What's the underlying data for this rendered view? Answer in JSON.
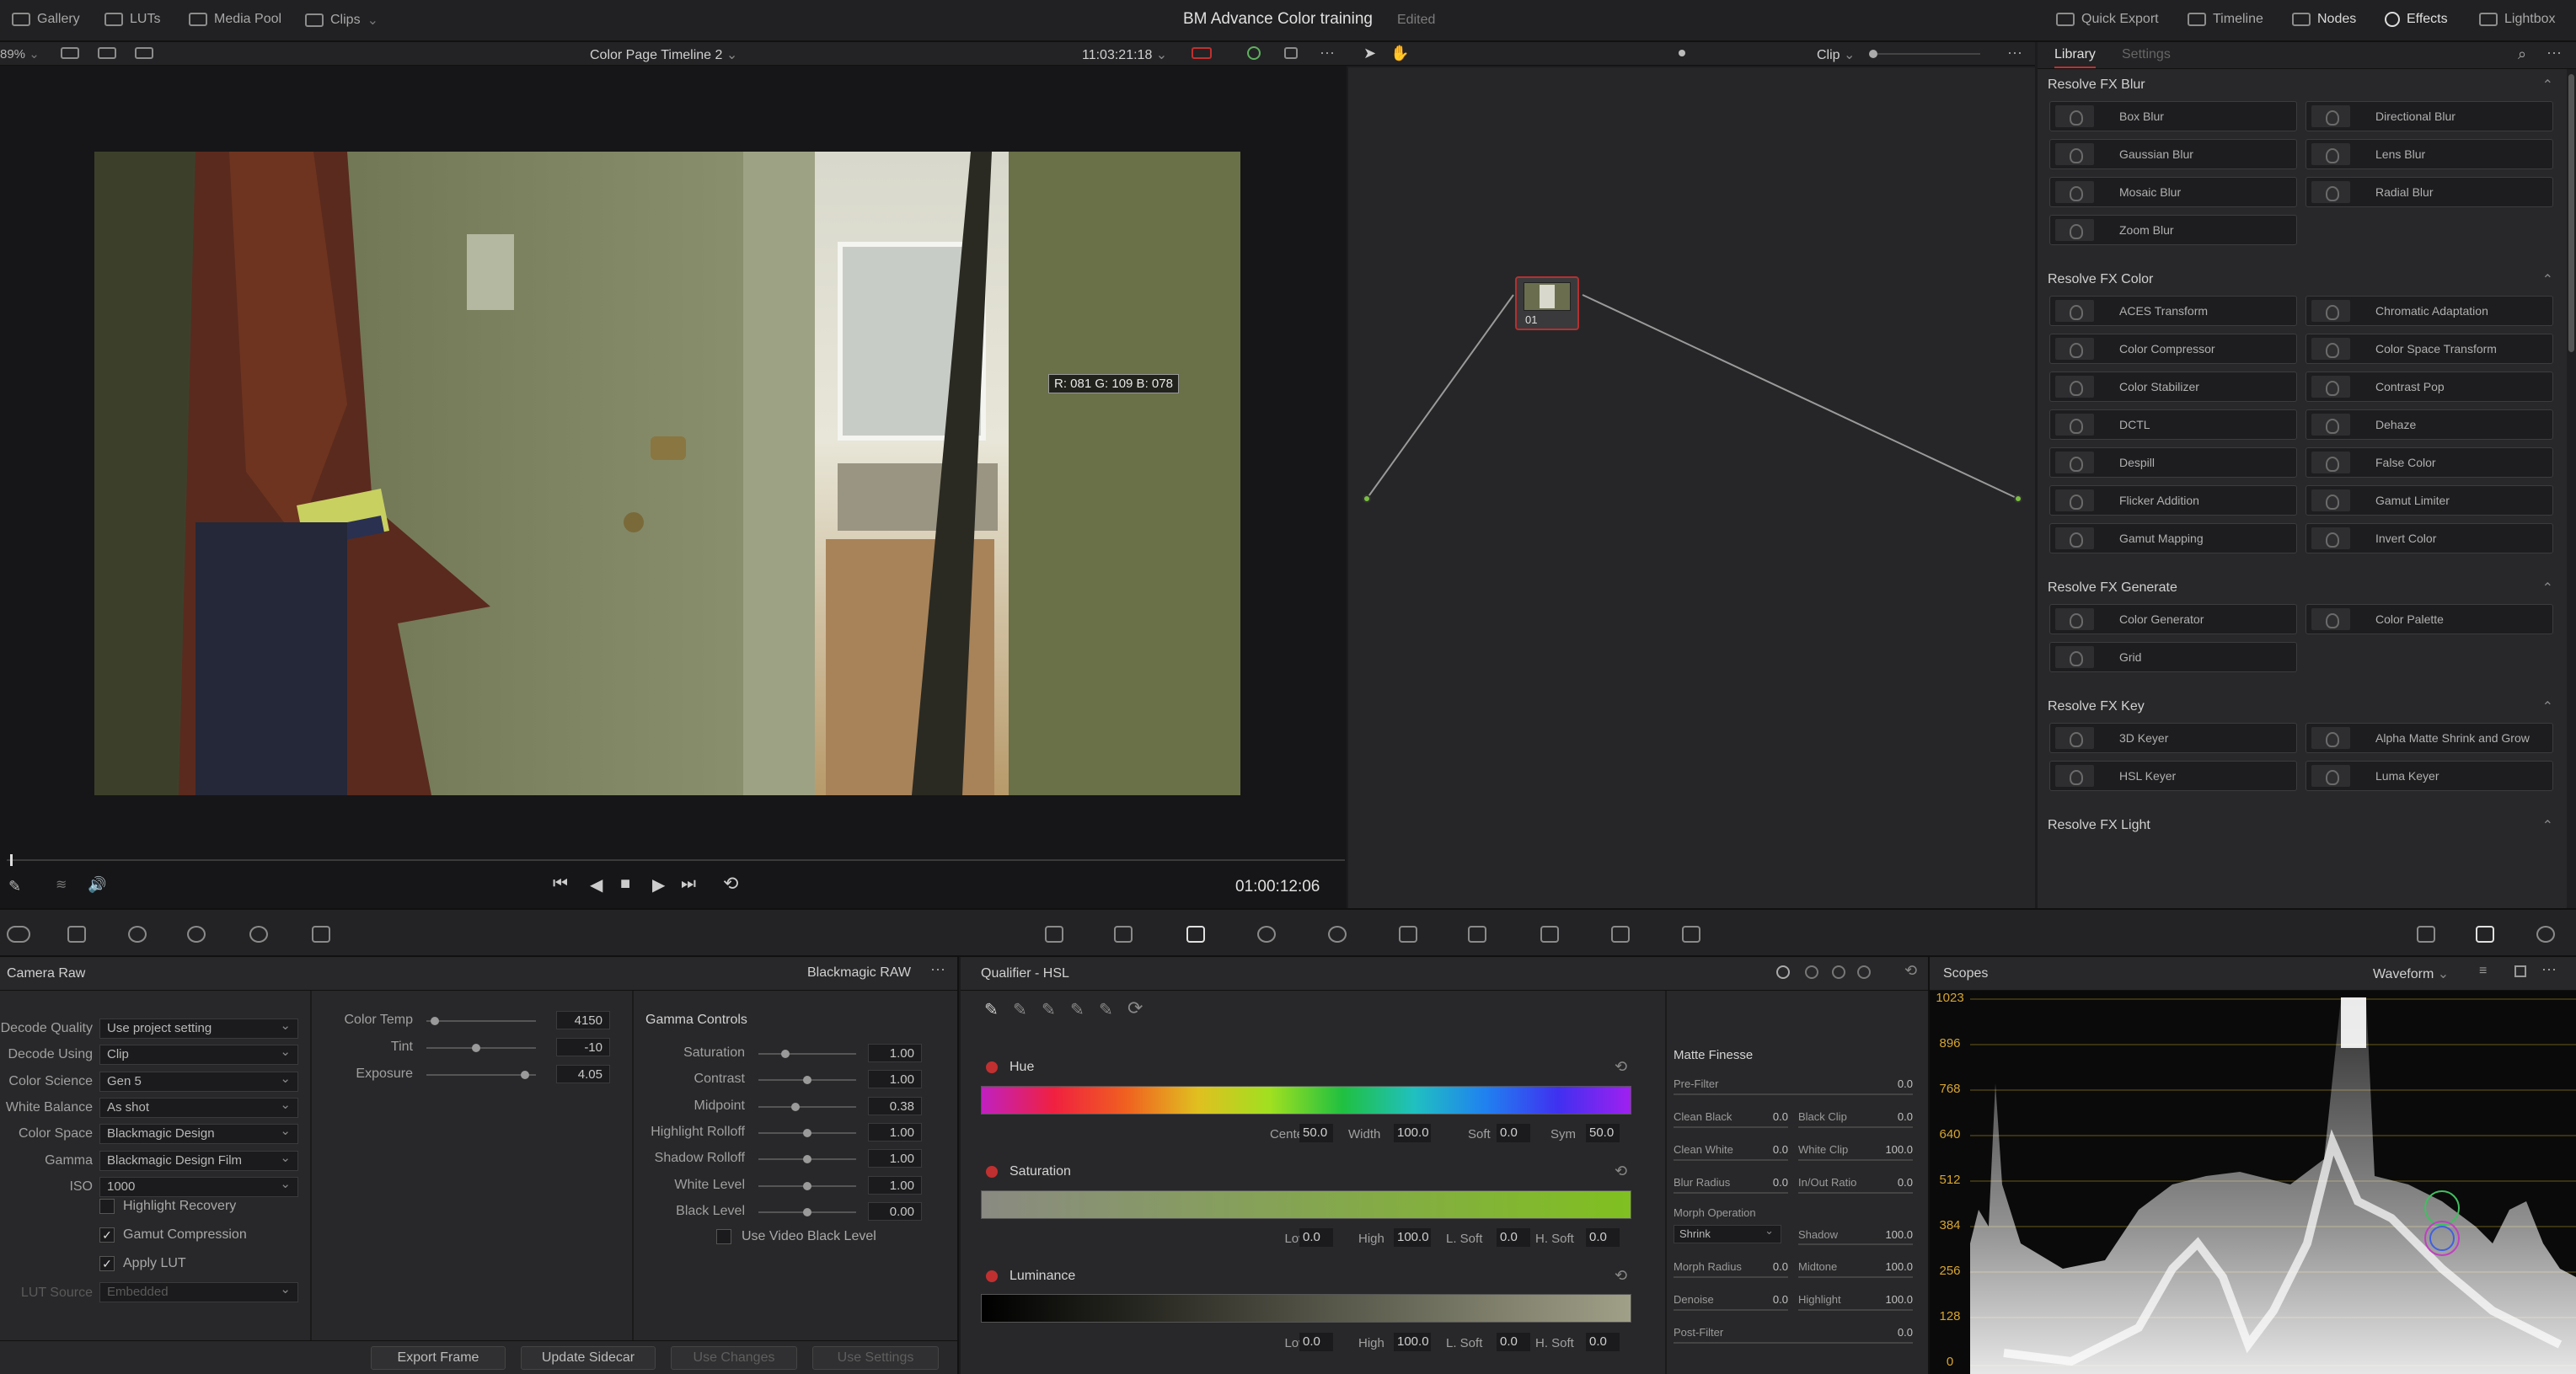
{
  "topbar": {
    "gallery": "Gallery",
    "luts": "LUTs",
    "media_pool": "Media Pool",
    "clips": "Clips",
    "project_title": "BM Advance Color training",
    "edited": "Edited",
    "quick_export": "Quick Export",
    "timeline": "Timeline",
    "nodes": "Nodes",
    "effects": "Effects",
    "lightbox": "Lightbox"
  },
  "viewer": {
    "zoom": "89%",
    "timeline_name": "Color Page Timeline 2",
    "source_timecode": "11:03:21:18",
    "pixel_readout": "R: 081  G: 109  B: 078",
    "playhead_timecode": "01:00:12:06"
  },
  "nodes": {
    "mode": "Clip",
    "node_label": "01"
  },
  "library": {
    "tab_library": "Library",
    "tab_settings": "Settings",
    "sections": [
      {
        "title": "Resolve FX Blur",
        "items": [
          "Box Blur",
          "Directional Blur",
          "Gaussian Blur",
          "Lens Blur",
          "Mosaic Blur",
          "Radial Blur",
          "Zoom Blur"
        ]
      },
      {
        "title": "Resolve FX Color",
        "items": [
          "ACES Transform",
          "Chromatic Adaptation",
          "Color Compressor",
          "Color Space Transform",
          "Color Stabilizer",
          "Contrast Pop",
          "DCTL",
          "Dehaze",
          "Despill",
          "False Color",
          "Flicker Addition",
          "Gamut Limiter",
          "Gamut Mapping",
          "Invert Color"
        ]
      },
      {
        "title": "Resolve FX Generate",
        "items": [
          "Color Generator",
          "Color Palette",
          "Grid"
        ]
      },
      {
        "title": "Resolve FX Key",
        "items": [
          "3D Keyer",
          "Alpha Matte Shrink and Grow",
          "HSL Keyer",
          "Luma Keyer"
        ]
      },
      {
        "title": "Resolve FX Light",
        "items": []
      }
    ]
  },
  "camera_raw": {
    "title": "Camera Raw",
    "format": "Blackmagic RAW",
    "rows": [
      {
        "label": "Decode Quality",
        "value": "Use project setting"
      },
      {
        "label": "Decode Using",
        "value": "Clip"
      },
      {
        "label": "Color Science",
        "value": "Gen 5"
      },
      {
        "label": "White Balance",
        "value": "As shot"
      },
      {
        "label": "Color Space",
        "value": "Blackmagic Design"
      },
      {
        "label": "Gamma",
        "value": "Blackmagic Design Film"
      },
      {
        "label": "ISO",
        "value": "1000"
      }
    ],
    "highlight_recovery": "Highlight Recovery",
    "gamut_compression": "Gamut Compression",
    "apply_lut": "Apply LUT",
    "lut_source_label": "LUT Source",
    "lut_source_value": "Embedded",
    "color_temp_label": "Color Temp",
    "color_temp": "4150",
    "color_temp_pos": 0.08,
    "tint_label": "Tint",
    "tint": "-10",
    "tint_pos": 0.45,
    "exposure_label": "Exposure",
    "exposure": "4.05",
    "exposure_pos": 0.9,
    "gamma_controls": "Gamma Controls",
    "gamma_rows": [
      {
        "label": "Saturation",
        "value": "1.00",
        "pos": 0.28
      },
      {
        "label": "Contrast",
        "value": "1.00",
        "pos": 0.5
      },
      {
        "label": "Midpoint",
        "value": "0.38",
        "pos": 0.38
      },
      {
        "label": "Highlight Rolloff",
        "value": "1.00",
        "pos": 0.5
      },
      {
        "label": "Shadow Rolloff",
        "value": "1.00",
        "pos": 0.5
      },
      {
        "label": "White Level",
        "value": "1.00",
        "pos": 0.5
      },
      {
        "label": "Black Level",
        "value": "0.00",
        "pos": 0.5
      }
    ],
    "use_video_black": "Use Video Black Level",
    "buttons": {
      "export_frame": "Export Frame",
      "update_sidecar": "Update Sidecar",
      "use_changes": "Use Changes",
      "use_settings": "Use Settings"
    }
  },
  "qualifier": {
    "title": "Qualifier - HSL",
    "hue": "Hue",
    "center_label": "Center",
    "center": "50.0",
    "width_label": "Width",
    "width": "100.0",
    "soft_label": "Soft",
    "soft": "0.0",
    "sym_label": "Sym",
    "sym": "50.0",
    "saturation": "Saturation",
    "luminance": "Luminance",
    "low_label": "Low",
    "high_label": "High",
    "lsoft_label": "L. Soft",
    "hsoft_label": "H. Soft",
    "sat_low": "0.0",
    "sat_high": "100.0",
    "sat_lsoft": "0.0",
    "sat_hsoft": "0.0",
    "lum_low": "0.0",
    "lum_high": "100.0",
    "lum_lsoft": "0.0",
    "lum_hsoft": "0.0",
    "matte_finesse": "Matte Finesse",
    "pre_filter_label": "Pre-Filter",
    "pre_filter": "0.0",
    "clean_black_label": "Clean Black",
    "clean_black": "0.0",
    "black_clip_label": "Black Clip",
    "black_clip": "0.0",
    "clean_white_label": "Clean White",
    "clean_white": "0.0",
    "white_clip_label": "White Clip",
    "white_clip": "100.0",
    "blur_radius_label": "Blur Radius",
    "blur_radius": "0.0",
    "inout_ratio_label": "In/Out Ratio",
    "inout_ratio": "0.0",
    "morph_op_label": "Morph Operation",
    "morph_op": "Shrink",
    "shadow_label": "Shadow",
    "shadow": "100.0",
    "morph_radius_label": "Morph Radius",
    "morph_radius": "0.0",
    "midtone_label": "Midtone",
    "midtone": "100.0",
    "denoise_label": "Denoise",
    "denoise": "0.0",
    "highlight_label": "Highlight",
    "highlight": "100.0",
    "post_filter_label": "Post-Filter",
    "post_filter": "0.0"
  },
  "scopes": {
    "title": "Scopes",
    "mode": "Waveform",
    "ticks": [
      "1023",
      "896",
      "768",
      "640",
      "512",
      "384",
      "256",
      "128",
      "0"
    ]
  }
}
